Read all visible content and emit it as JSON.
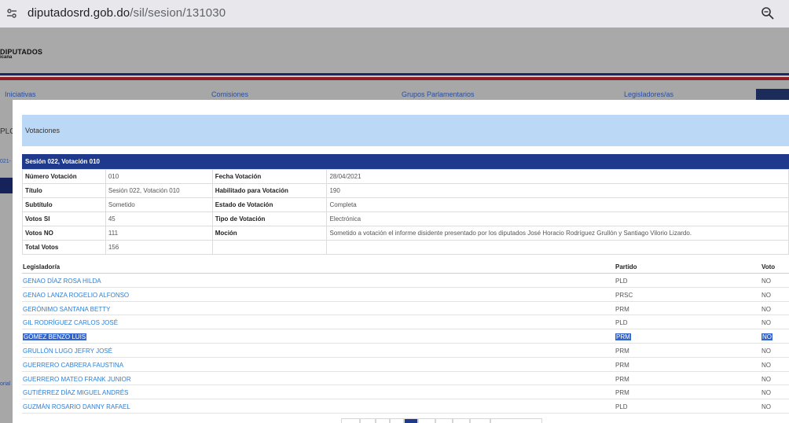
{
  "browser": {
    "url_host": "diputadosrd.gob.do",
    "url_path": "/sil/sesion/131030"
  },
  "site": {
    "logo_main": "DIPUTADOS",
    "logo_sub": "icana",
    "nav": [
      "Iniciativas",
      "Comisiones",
      "Grupos Parlamentarios",
      "Legisladores/as"
    ],
    "side_fragments": [
      "PLO",
      "021-",
      "orial"
    ]
  },
  "modal": {
    "title": "Votaciones",
    "section_title": "Sesión 022, Votación 010",
    "info": {
      "numero_votacion_label": "Número Votación",
      "numero_votacion": "010",
      "fecha_votacion_label": "Fecha Votación",
      "fecha_votacion": "28/04/2021",
      "titulo_label": "Título",
      "titulo": "Sesión 022, Votación 010",
      "habilitado_label": "Habilitado para Votación",
      "habilitado": "190",
      "subtitulo_label": "Subtítulo",
      "subtitulo": "Sometido",
      "estado_label": "Estado de Votación",
      "estado": "Completa",
      "votos_si_label": "Votos SI",
      "votos_si": "45",
      "tipo_label": "Tipo de Votación",
      "tipo": "Electrónica",
      "votos_no_label": "Votos NO",
      "votos_no": "111",
      "mocion_label": "Moción",
      "mocion": "Sometido a votación el informe disidente presentado por los diputados José Horacio Rodríguez Grullón y Santiago Vilorio Lizardo.",
      "total_votos_label": "Total Votos",
      "total_votos": "156"
    },
    "votes_header": {
      "legislador": "Legislador/a",
      "partido": "Partido",
      "voto": "Voto"
    },
    "votes": [
      {
        "name": "GENAO DÍAZ ROSA HILDA",
        "party": "PLD",
        "vote": "NO"
      },
      {
        "name": "GENAO LANZA ROGELIO ALFONSO",
        "party": "PRSC",
        "vote": "NO"
      },
      {
        "name": "GERÓNIMO SANTANA BETTY",
        "party": "PRM",
        "vote": "NO"
      },
      {
        "name": "GIL RODRÍGUEZ CARLOS JOSÉ",
        "party": "PLD",
        "vote": "NO"
      },
      {
        "name": "GÓMEZ BENZO LUIS",
        "party": "PRM",
        "vote": "NO"
      },
      {
        "name": "GRULLÓN LUGO JEFRY JOSÉ",
        "party": "PRM",
        "vote": "NO"
      },
      {
        "name": "GUERRERO CABRERA FAUSTINA",
        "party": "PRM",
        "vote": "NO"
      },
      {
        "name": "GUERRERO MATEO FRANK JUNIOR",
        "party": "PRM",
        "vote": "NO"
      },
      {
        "name": "GUTIÉRREZ DÍAZ MIGUEL ANDRÉS",
        "party": "PRM",
        "vote": "NO"
      },
      {
        "name": "GUZMÁN ROSARIO DANNY RAFAEL",
        "party": "PLD",
        "vote": "NO"
      }
    ]
  },
  "colors": {
    "section_bar": "#1f3a8c",
    "title_bar": "#bcd8f7",
    "link": "#2c7fd6",
    "selection": "#3366cc"
  }
}
